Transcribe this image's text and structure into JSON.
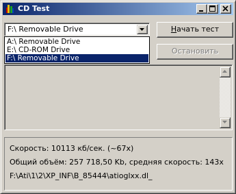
{
  "window": {
    "title": "CD Test",
    "icon": "cd-test-app-icon",
    "controls": {
      "minimize": "minimize-icon",
      "maximize": "maximize-icon",
      "close": "close-icon"
    }
  },
  "drive_select": {
    "selected": "F:\\ Removable Drive",
    "options": [
      "A:\\ Removable Drive",
      "E:\\ CD-ROM Drive",
      "F:\\ Removable Drive"
    ],
    "highlighted_index": 2
  },
  "buttons": {
    "start_mnemonic": "Н",
    "start_rest": "ачать тест",
    "stop_label": "Остановить",
    "stop_enabled": false
  },
  "status": {
    "speed": "Скорость: 10113 кб/сек. (~67x)",
    "total": "Общий объём: 257 718,50 Kb, средняя скорость: 143x",
    "current_file": "F:\\Ati\\1\\2\\XP_INF\\B_85444\\atioglxx.dl_"
  },
  "colors": {
    "face": "#d4d0c8",
    "title_active": "#0a246a",
    "title_gradient_end": "#a6caf0",
    "selection": "#0a246a",
    "disabled_text": "#808080"
  }
}
